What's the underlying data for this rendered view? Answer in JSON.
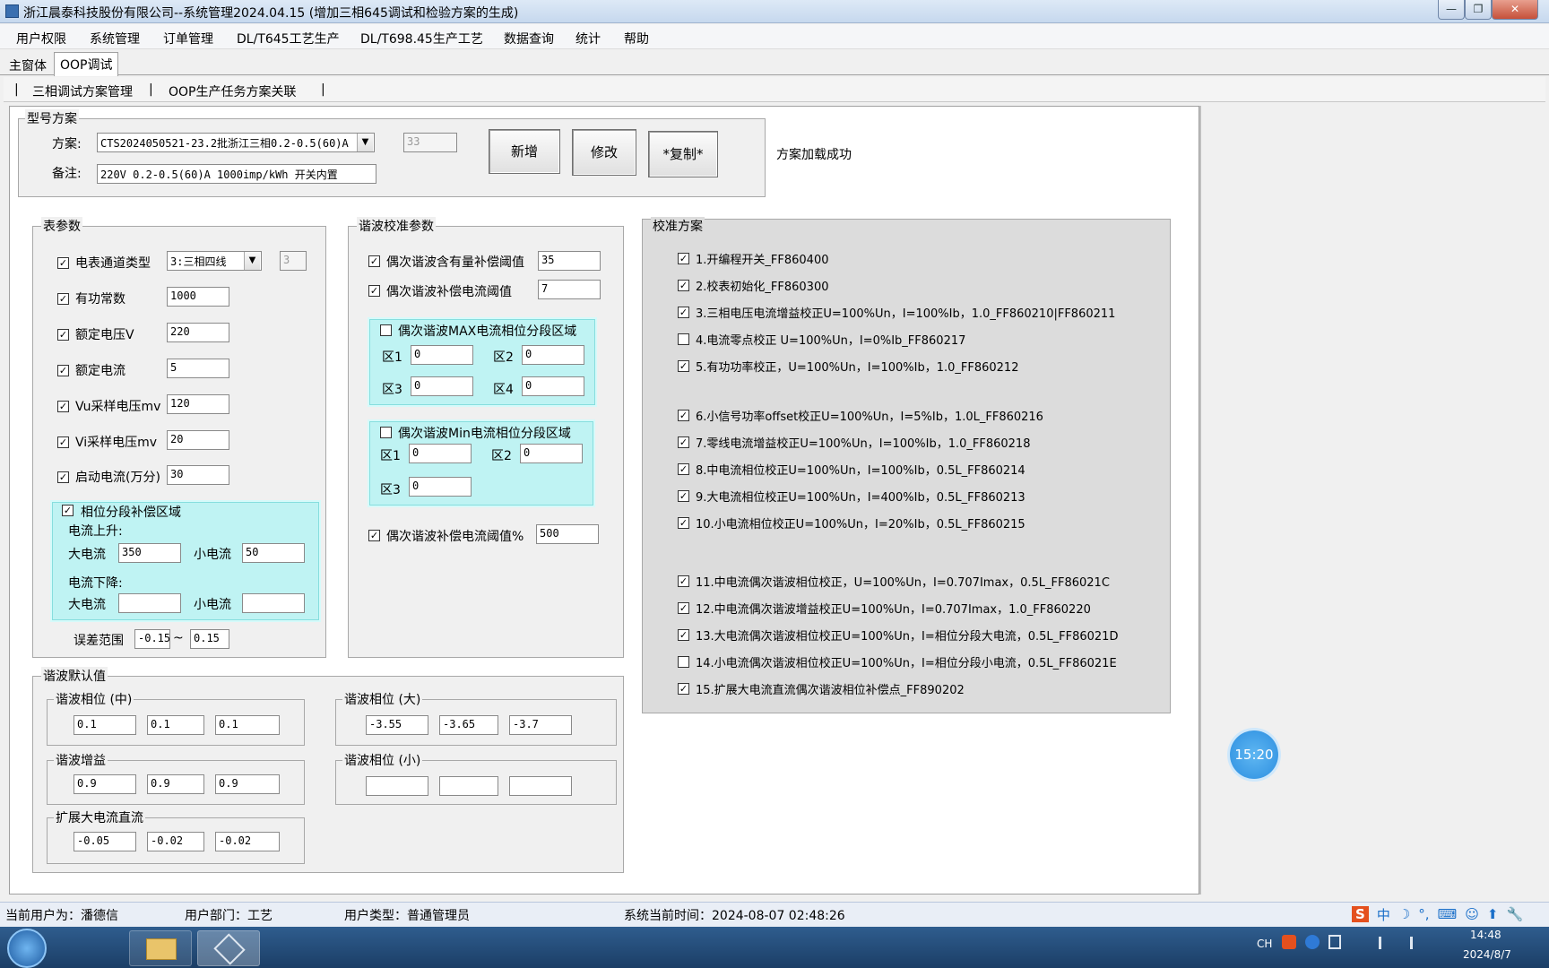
{
  "window": {
    "title": "浙江晨泰科技股份有限公司--系统管理2024.04.15 (增加三相645调试和检验方案的生成)",
    "minimize": "—",
    "maximize": "❐",
    "close": "✕"
  },
  "menu": [
    "用户权限",
    "系统管理",
    "订单管理",
    "DL/T645工艺生产",
    "DL/T698.45生产工艺",
    "数据查询",
    "统计",
    "帮助"
  ],
  "tabs": [
    "主窗体",
    "OOP调试"
  ],
  "subtabs": [
    "三相调试方案管理",
    "OOP生产任务方案关联"
  ],
  "scheme": {
    "group_title": "型号方案",
    "scheme_label": "方案:",
    "scheme_value": "CTS2024050521-23.2批浙江三相0.2-0.5(60)A",
    "scheme_id": "33",
    "note_label": "备注:",
    "note_value": "220V 0.2-0.5(60)A 1000imp/kWh 开关内置",
    "btn_new": "新增",
    "btn_edit": "修改",
    "btn_copy": "*复制*",
    "status": "方案加载成功"
  },
  "meter_params": {
    "title": "表参数",
    "rows": [
      {
        "label": "电表通道类型",
        "value": "3:三相四线",
        "checked": true
      },
      {
        "label": "有功常数",
        "value": "1000",
        "checked": true
      },
      {
        "label": "额定电压V",
        "value": "220",
        "checked": true
      },
      {
        "label": "额定电流",
        "value": "5",
        "checked": true
      },
      {
        "label": "Vu采样电压mv",
        "value": "120",
        "checked": true
      },
      {
        "label": "Vi采样电压mv",
        "value": "20",
        "checked": true
      },
      {
        "label": "启动电流(万分)",
        "value": "30",
        "checked": true
      }
    ],
    "channel_code": "3",
    "phase_title": "相位分段补偿区域",
    "rise_label": "电流上升:",
    "fall_label": "电流下降:",
    "large_label": "大电流",
    "small_label": "小电流",
    "rise_large": "350",
    "rise_small": "50",
    "fall_large": "",
    "fall_small": "",
    "err_label": "误差范围",
    "err_min": "-0.15",
    "err_sep": "~",
    "err_max": "0.15"
  },
  "harmonic": {
    "title": "谐波校准参数",
    "row1_label": "偶次谐波含有量补偿阈值",
    "row1_value": "35",
    "row2_label": "偶次谐波补偿电流阈值",
    "row2_value": "7",
    "max_title": "偶次谐波MAX电流相位分段区域",
    "min_title": "偶次谐波Min电流相位分段区域",
    "z1": "区1",
    "z2": "区2",
    "z3": "区3",
    "z4": "区4",
    "max_values": [
      "0",
      "0",
      "0",
      "0"
    ],
    "min_values": [
      "0",
      "0",
      "0"
    ],
    "row3_label": "偶次谐波补偿电流阈值%",
    "row3_value": "500"
  },
  "calibration": {
    "title": "校准方案",
    "items": [
      {
        "label": "1.开编程开关_FF860400",
        "checked": true
      },
      {
        "label": "2.校表初始化_FF860300",
        "checked": true
      },
      {
        "label": "3.三相电压电流增益校正U=100%Un，I=100%Ib，1.0_FF860210|FF860211",
        "checked": true
      },
      {
        "label": "4.电流零点校正 U=100%Un，I=0%Ib_FF860217",
        "checked": false
      },
      {
        "label": "5.有功功率校正，U=100%Un，I=100%Ib，1.0_FF860212",
        "checked": true
      },
      {
        "label": "6.小信号功率offset校正U=100%Un，I=5%Ib，1.0L_FF860216",
        "checked": true
      },
      {
        "label": "7.零线电流增益校正U=100%Un，I=100%Ib，1.0_FF860218",
        "checked": true
      },
      {
        "label": "8.中电流相位校正U=100%Un，I=100%Ib，0.5L_FF860214",
        "checked": true
      },
      {
        "label": "9.大电流相位校正U=100%Un，I=400%Ib，0.5L_FF860213",
        "checked": true
      },
      {
        "label": "10.小电流相位校正U=100%Un，I=20%Ib，0.5L_FF860215",
        "checked": true
      },
      {
        "label": "11.中电流偶次谐波相位校正，U=100%Un，I=0.707Imax，0.5L_FF86021C",
        "checked": true
      },
      {
        "label": "12.中电流偶次谐波增益校正U=100%Un，I=0.707Imax，1.0_FF860220",
        "checked": true
      },
      {
        "label": "13.大电流偶次谐波相位校正U=100%Un，I=相位分段大电流，0.5L_FF86021D",
        "checked": true
      },
      {
        "label": "14.小电流偶次谐波相位校正U=100%Un，I=相位分段小电流，0.5L_FF86021E",
        "checked": false
      },
      {
        "label": "15.扩展大电流直流偶次谐波相位补偿点_FF890202",
        "checked": true
      }
    ]
  },
  "defaults": {
    "title": "谐波默认值",
    "phase_mid_title": "谐波相位 (中)",
    "phase_mid": [
      "0.1",
      "0.1",
      "0.1"
    ],
    "phase_large_title": "谐波相位 (大)",
    "phase_large": [
      "-3.55",
      "-3.65",
      "-3.7"
    ],
    "gain_title": "谐波增益",
    "gain": [
      "0.9",
      "0.9",
      "0.9"
    ],
    "phase_small_title": "谐波相位 (小)",
    "phase_small": [
      "",
      "",
      ""
    ],
    "ext_title": "扩展大电流直流",
    "ext": [
      "-0.05",
      "-0.02",
      "-0.02"
    ]
  },
  "floating_clock": "15:20",
  "status": {
    "user": "当前用户为：潘德信",
    "dept": "用户部门：工艺",
    "type": "用户类型：普通管理员",
    "time": "系统当前时间：2024-08-07 02:48:26"
  },
  "ime": [
    "S",
    "中",
    "☽",
    "°,",
    "⌨",
    "☺",
    "⬆",
    "🔧"
  ],
  "taskbar": {
    "lang": "CH",
    "time": "14:48",
    "date": "2024/8/7"
  },
  "colors": {
    "cyan_panel": "#bff3f3",
    "taskbar": "#1b3e66",
    "clock": "#2c8ee0"
  }
}
